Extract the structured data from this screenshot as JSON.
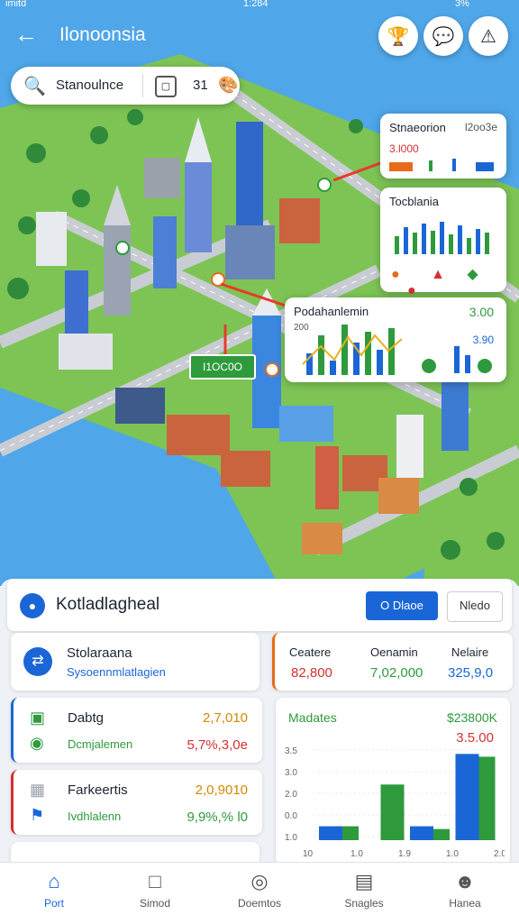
{
  "status": {
    "left": "imitd",
    "center": "1:284",
    "right": "3%"
  },
  "header": {
    "title": "Ilonoonsia",
    "icons": [
      "award-icon",
      "chat-icon",
      "alert-icon"
    ]
  },
  "search": {
    "text": "Stanoulnce",
    "count": "31"
  },
  "cards": {
    "top": {
      "title": "Stnaeorion",
      "value": "l2oo3e",
      "sub": "3.l000"
    },
    "mid": {
      "title": "Tocblania"
    },
    "big": {
      "title": "Podahanlemin",
      "value1": "3.00",
      "value2": "3.90",
      "axis": "200",
      "bars": [
        30,
        55,
        20,
        70,
        45,
        60,
        35,
        65
      ]
    },
    "pill": "I1OC0O"
  },
  "panel": {
    "title": "Kotladlagheal",
    "btn_primary": "O Dlaoe",
    "btn_secondary": "Nledo"
  },
  "summary": {
    "title": "Stolaraana",
    "subtitle": "Sysoennmlatlagien"
  },
  "stats": [
    {
      "label": "Ceatere",
      "value": "82,800",
      "color": "#d33030"
    },
    {
      "label": "Oenamin",
      "value": "7,02,000",
      "color": "#2e9a3c"
    },
    {
      "label": "Nelaire",
      "value": "325,9,0",
      "color": "#1b66d6"
    }
  ],
  "list": [
    {
      "title": "Dabtg",
      "value": "2,7,010",
      "sub": "Dcmjalemen",
      "subvalue": "5,7%,3,0e",
      "accent": "#1b66d6"
    },
    {
      "title": "Farkeertis",
      "value": "2,0,9010",
      "sub": "Ivdhlalenn",
      "subvalue": "9,9%,%  l0",
      "accent": "#d33030"
    }
  ],
  "chart_panel": {
    "title": "Madates",
    "value": "$23800K",
    "peak": "3.5.00",
    "yticks": [
      "3.5",
      "3.0",
      "2.0",
      "0.0",
      "1.0"
    ],
    "xticks": [
      "10",
      "1.0",
      "1.9",
      "1.0",
      "2.0"
    ],
    "chart_data": {
      "type": "bar",
      "categories": [
        "1.0",
        "1.9",
        "1.0",
        "2.0"
      ],
      "series": [
        {
          "values": [
            0.5,
            2.0,
            0.4,
            3.0
          ],
          "color": "#2e9a3c"
        },
        {
          "values": [
            0.5,
            0.0,
            0.5,
            3.1
          ],
          "color": "#1b66d6"
        }
      ]
    }
  },
  "nav": [
    {
      "label": "Port",
      "icon": "home-icon",
      "active": true
    },
    {
      "label": "Simod",
      "icon": "cup-icon",
      "active": false
    },
    {
      "label": "Doemtos",
      "icon": "compass-icon",
      "active": false
    },
    {
      "label": "Snagles",
      "icon": "book-icon",
      "active": false
    },
    {
      "label": "Hanea",
      "icon": "user-icon",
      "active": false
    }
  ]
}
